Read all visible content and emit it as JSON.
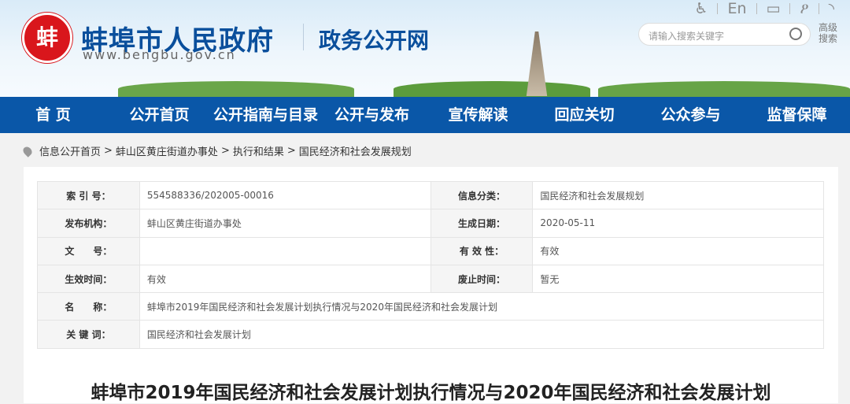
{
  "header": {
    "logo_text": "蚌",
    "site_title": "蚌埠市人民政府",
    "site_url": "www.bengbu.gov.cn",
    "sub_title": "政务公开网",
    "tools": {
      "english": "En"
    },
    "search_placeholder": "请输入搜索关键字",
    "advanced_search": "高级搜索"
  },
  "nav": [
    "首 页",
    "公开首页",
    "公开指南与目录",
    "公开与发布",
    "宣传解读",
    "回应关切",
    "公众参与",
    "监督保障"
  ],
  "breadcrumb": [
    "信息公开首页",
    ">",
    "蚌山区黄庄街道办事处",
    ">",
    "执行和结果",
    ">",
    "国民经济和社会发展规划"
  ],
  "meta": {
    "index_label": "索 引 号：",
    "index": "554588336/202005-00016",
    "category_label": "信息分类：",
    "category": "国民经济和社会发展规划",
    "publisher_label": "发布机构：",
    "publisher": "蚌山区黄庄街道办事处",
    "date_label": "生成日期：",
    "date": "2020-05-11",
    "docno_label": "文　　号：",
    "docno": "",
    "validity_label": "有 效 性：",
    "validity": "有效",
    "effective_label": "生效时间：",
    "effective": "有效",
    "expire_label": "废止时间：",
    "expire": "暂无",
    "name_label": "名　　称：",
    "name": "蚌埠市2019年国民经济和社会发展计划执行情况与2020年国民经济和社会发展计划",
    "keyword_label": "关 键 词：",
    "keyword": "国民经济和社会发展计划"
  },
  "article_title": "蚌埠市2019年国民经济和社会发展计划执行情况与2020年国民经济和社会发展计划"
}
